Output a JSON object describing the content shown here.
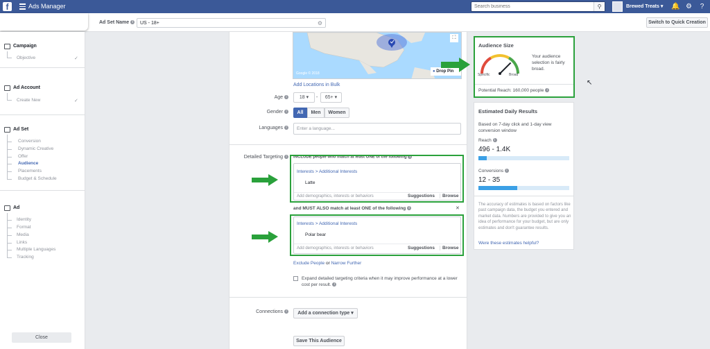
{
  "topbar": {
    "brand": "Ads Manager",
    "search_placeholder": "Search business",
    "account_name": "Brewed Treats"
  },
  "header": {
    "adset_label": "Ad Set Name",
    "adset_value": "US - 18+",
    "switch_button": "Switch to Quick Creation"
  },
  "sidebar": {
    "campaign": {
      "title": "Campaign",
      "items": [
        "Objective"
      ]
    },
    "adaccount": {
      "title": "Ad Account",
      "items": [
        "Create New"
      ]
    },
    "adset": {
      "title": "Ad Set",
      "items": [
        "Conversion",
        "Dynamic Creative",
        "Offer",
        "Audience",
        "Placements",
        "Budget & Schedule"
      ]
    },
    "ad": {
      "title": "Ad",
      "items": [
        "Identity",
        "Format",
        "Media",
        "Links",
        "Multiple Languages",
        "Tracking"
      ]
    },
    "close": "Close"
  },
  "map": {
    "copyright": "Google © 2018",
    "drop_pin": "Drop Pin"
  },
  "form": {
    "add_locations": "Add Locations in Bulk",
    "age_label": "Age",
    "age_min": "18",
    "age_dash": "-",
    "age_max": "65+",
    "gender_label": "Gender",
    "gender_options": [
      "All",
      "Men",
      "Women"
    ],
    "languages_label": "Languages",
    "languages_placeholder": "Enter a language...",
    "detailed_label": "Detailed Targeting",
    "include_text": "INCLUDE people who match at least ONE of the following",
    "box1_path": "Interests > Additional Interests",
    "box1_item": "Latte",
    "box_placeholder": "Add demographics, interests or behaviors",
    "suggestions": "Suggestions",
    "browse": "Browse",
    "and_must": "and MUST ALSO match at least ONE of the following",
    "close_x": "✕",
    "box2_path": "Interests > Additional Interests",
    "box2_item": "Polar bear",
    "exclude": "Exclude People",
    "or": "or",
    "narrow": "Narrow Further",
    "expand_text": "Expand detailed targeting criteria when it may improve performance at a lower cost per result.",
    "connections_label": "Connections",
    "connection_btn": "Add a connection type",
    "save_audience": "Save This Audience"
  },
  "audience": {
    "title": "Audience Size",
    "desc": "Your audience selection is fairly broad.",
    "specific": "Specific",
    "broad": "Broad",
    "reach": "Potential Reach: 160,000 people",
    "gauge_level": 0.75
  },
  "daily": {
    "title": "Estimated Daily Results",
    "window": "Based on 7-day click and 1-day view conversion window",
    "reach_label": "Reach",
    "reach_value": "496 - 1.4K",
    "reach_fill": 0.09,
    "conv_label": "Conversions",
    "conv_value": "12 - 35",
    "conv_fill": 0.43,
    "disclaimer": "The accuracy of estimates is based on factors like past campaign data, the budget you entered and market data. Numbers are provided to give you an idea of performance for your budget, but are only estimates and don't guarantee results.",
    "helpful": "Were these estimates helpful?"
  },
  "colors": {
    "brand_blue": "#3b5998",
    "annotation_green": "#2aa13b",
    "link_blue": "#4267b2"
  }
}
